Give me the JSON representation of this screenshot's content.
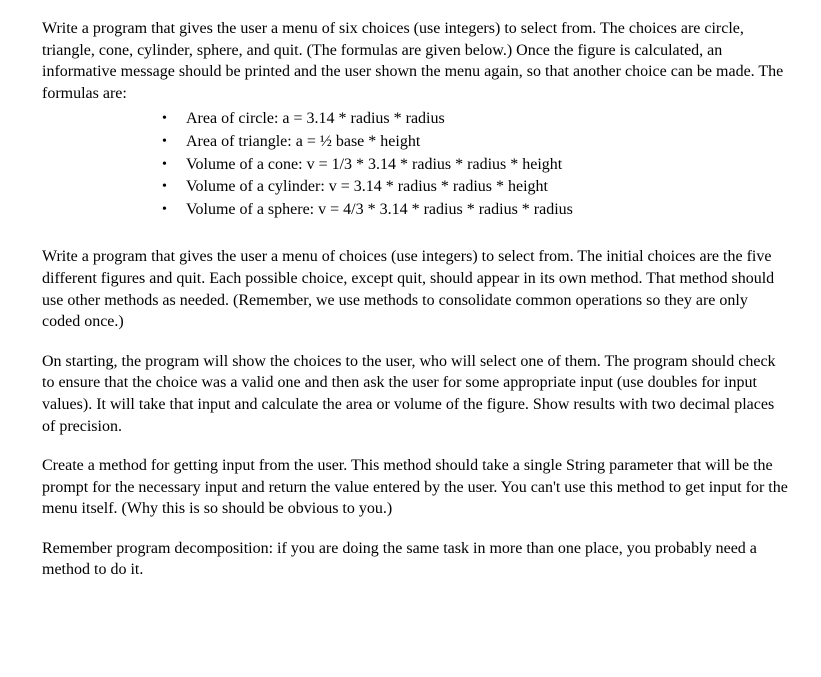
{
  "intro_para": "Write a program that gives the user a menu of six choices (use integers) to select from.  The choices are circle, triangle, cone, cylinder, sphere, and quit.  (The formulas are given below.)  Once the figure is calculated, an informative message should be printed and the user shown the menu again, so that another choice can be made.  The formulas are:",
  "formulas": [
    "Area of circle: a = 3.14 * radius * radius",
    "Area of triangle: a = ½ base * height",
    "Volume of a cone: v = 1/3 * 3.14 * radius * radius * height",
    "Volume of a cylinder: v = 3.14 * radius * radius * height",
    "Volume of a sphere: v = 4/3 * 3.14 * radius * radius * radius"
  ],
  "para2": "Write a program that gives the user a menu of choices (use integers) to select from.  The initial choices are the five different figures and quit.  Each possible choice, except quit, should appear in its own method.  That method should use other methods as needed. (Remember, we use methods to consolidate common operations so they are only coded once.)",
  "para3": "On starting, the program will show the choices to the user, who will select one of them.  The program should check to ensure that the choice was a valid one and then ask the user for some appropriate input (use doubles for input values).  It will take that input and calculate the area or volume of the figure. Show results with two decimal places of precision.",
  "para4": "Create a method for getting input from the user.  This method should take a single String parameter that will be the prompt for the necessary input and return the value entered by the user.  You can't use this method to get input for the menu itself.  (Why this is so should be obvious to you.)",
  "para5": "Remember program decomposition: if you are doing the same task in more than one place, you probably need a method to do it."
}
